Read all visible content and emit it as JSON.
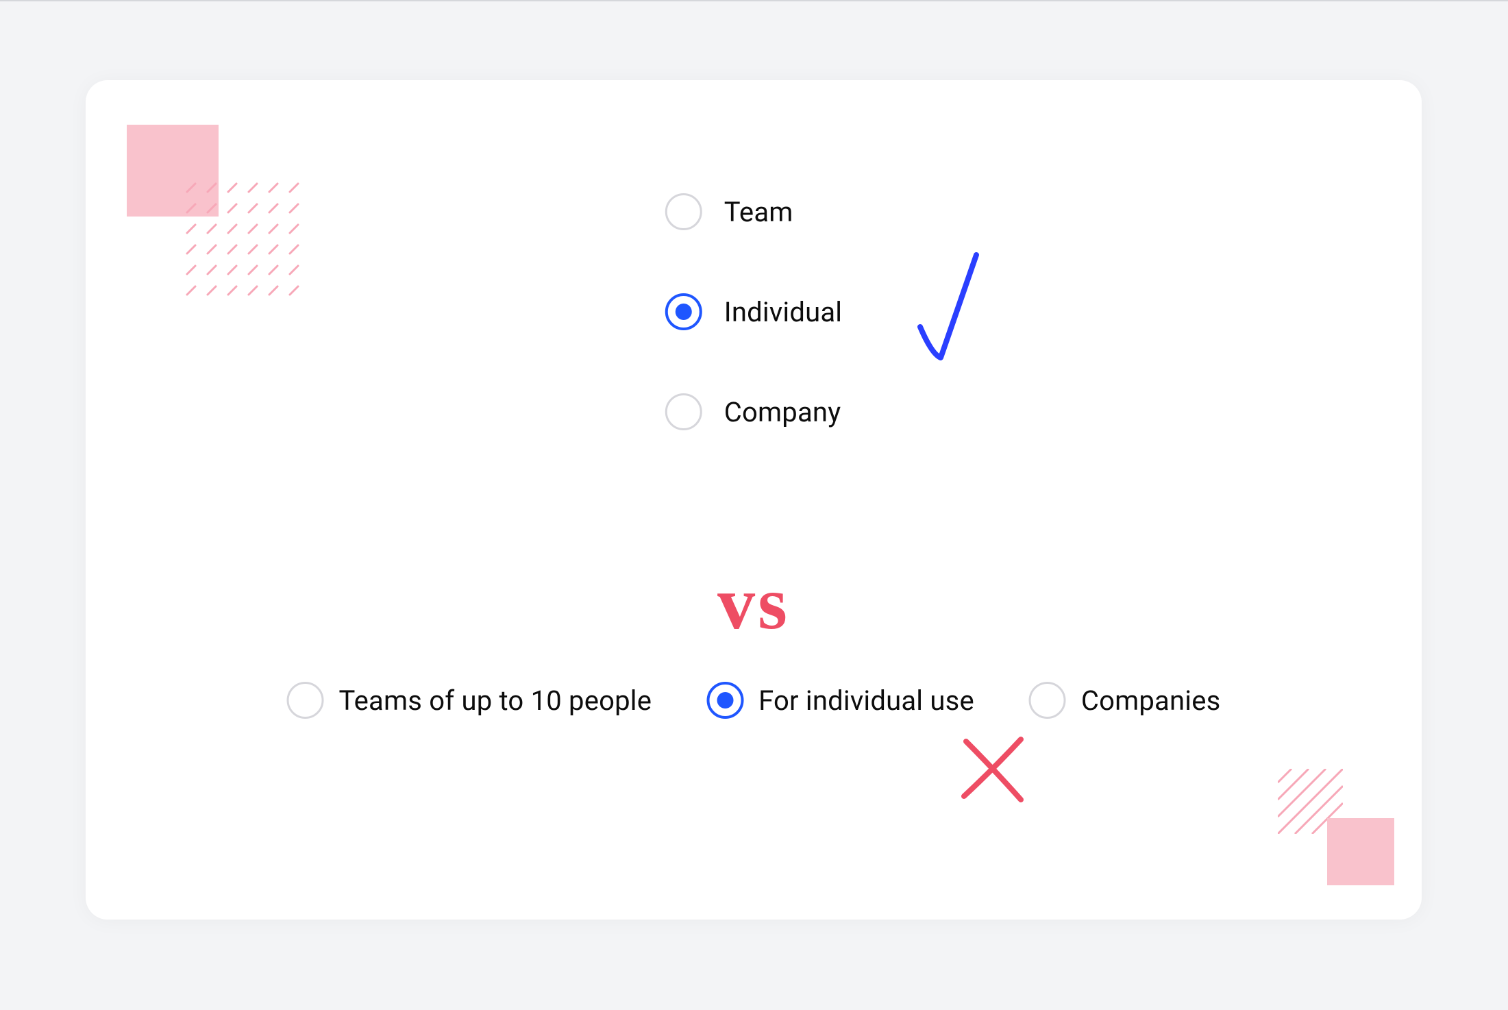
{
  "group_a": {
    "options": [
      {
        "label": "Team",
        "selected": false
      },
      {
        "label": "Individual",
        "selected": true
      },
      {
        "label": "Company",
        "selected": false
      }
    ]
  },
  "vs_text": "vs",
  "group_b": {
    "options": [
      {
        "label": "Teams of up to 10 people",
        "selected": false
      },
      {
        "label": "For individual use",
        "selected": true
      },
      {
        "label": "Companies",
        "selected": false
      }
    ]
  },
  "annotations": {
    "check_color": "#2a3fff",
    "cross_color": "#ee4d64"
  },
  "colors": {
    "accent_blue": "#1f56ff",
    "accent_pink": "#ee4d64",
    "deco_pink": "#f9c2cc",
    "border_gray": "#d6d6db",
    "page_bg": "#f3f4f6",
    "card_bg": "#ffffff"
  }
}
